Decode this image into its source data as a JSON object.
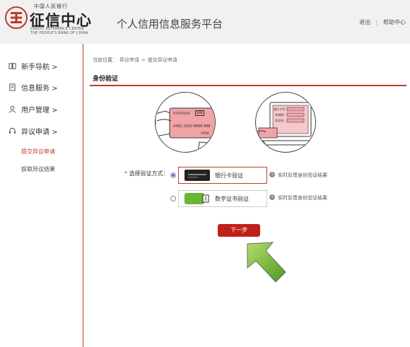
{
  "header": {
    "logo_top": "中国人民银行",
    "logo_cn": "征信中心",
    "logo_en_line1": "CREDIT REFERENCE CENTER",
    "logo_en_line2": "THE PEOPLE'S BANK OF CHINA",
    "platform_title": "个人信用信息服务平台",
    "links": {
      "logout": "退出",
      "separator": "|",
      "help": "帮助中心"
    }
  },
  "sidebar": {
    "items": [
      {
        "label": "新手导航 >",
        "icon": "book-icon"
      },
      {
        "label": "信息服务 >",
        "icon": "document-icon"
      },
      {
        "label": "用户管理 >",
        "icon": "user-icon"
      },
      {
        "label": "异议申请 >",
        "icon": "headset-icon"
      }
    ],
    "sub_items": [
      {
        "label": "提交异议申请",
        "active": true
      },
      {
        "label": "获取异议结果",
        "active": false
      }
    ]
  },
  "main": {
    "breadcrumb": {
      "prefix": "当前位置：",
      "level1": "异议申请",
      "sep": ">",
      "level2": "提交异议申请"
    },
    "section_title": "身份验证",
    "illustration_card": {
      "card_code": "XXXXXXX",
      "card_tag": "银联",
      "card_number": "4392 2500 8888 888",
      "card_brand": "VISA"
    },
    "illustration_laptop": {
      "field1": "银行卡号：",
      "field2": "有效期：",
      "field3": "验证码："
    },
    "select_label": {
      "required": "*",
      "text": "选择验证方式："
    },
    "options": [
      {
        "label": "银行卡验证",
        "checked": true,
        "info": "实时反馈身份验证结果"
      },
      {
        "label": "数字证书验证",
        "checked": false,
        "info": "实时反馈身份验证结果"
      }
    ],
    "next_button": "下一步"
  },
  "colors": {
    "accent": "#c0392b",
    "button": "#c0201c",
    "arrow": "#5aa02c",
    "radio": "#2a6bd8"
  }
}
